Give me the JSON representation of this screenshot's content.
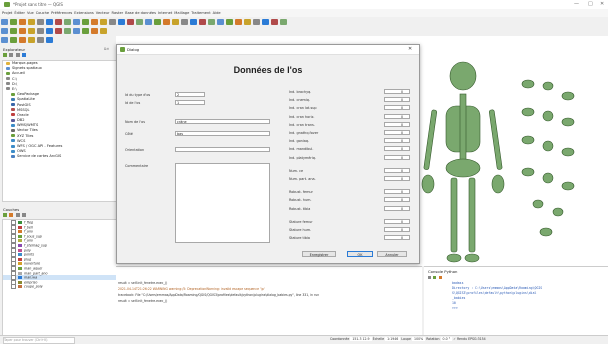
{
  "window": {
    "title": "*Projet sans titre — QGIS"
  },
  "menu": [
    "Projet",
    "Éditer",
    "Vue",
    "Couche",
    "Préférences",
    "Extensions",
    "Vecteur",
    "Raster",
    "Base de données",
    "Internet",
    "Maillage",
    "Traitement",
    "Aide"
  ],
  "explorer": {
    "title": "Explorateur",
    "items": [
      "Marque-pages",
      "Signets spatiaux",
      "Accueil",
      "C:\\",
      "D:\\",
      "E:\\",
      "GeoPackage",
      "SpatiaLite",
      "PostGIS",
      "MSSQL",
      "Oracle",
      "DB2",
      "WMS/WMTS",
      "Vector Tiles",
      "XYZ Tiles",
      "WCS",
      "WFS / OGC API - Features",
      "OWS",
      "Service de cartes ArcGIS"
    ]
  },
  "layers": {
    "title": "Couches",
    "items": [
      "f_fleg",
      "f_bell",
      "f_ano",
      "f_sous_sup",
      "f_ano",
      "f_sternag_sup",
      "poly",
      "points",
      "plug",
      "ouverture",
      "man_aquel",
      "man_part_ano",
      "man.wa",
      "empriso",
      "coupe_poly"
    ]
  },
  "dialog": {
    "window_title": "Dialog",
    "heading": "Données de l'os",
    "id_type_os_label": "Id du type d'os",
    "id_type_os_value": "2",
    "id_os_label": "Id de l'os",
    "id_os_value": "1",
    "nom_label": "Nom de l'os",
    "nom_value": "crâne",
    "cote_label": "Côté",
    "cote_value": "bas",
    "orientation_label": "Orientation",
    "commentaire_label": "Commentaire",
    "right_fields": [
      "Ind. brachyq.",
      "Ind. cnemiq.",
      "Ind. cran lat.sup",
      "Ind. cran horiz.",
      "Ind. cran trans.",
      "Ind. gnathq.fover",
      "Ind. goniaq.",
      "Ind. mandibul.",
      "Ind. platymériq.",
      "Num. ce",
      "Num. part. ana.",
      "Robust. femur",
      "Robust. hum.",
      "Robust. tibia",
      "Stature femur",
      "Stature hum.",
      "Stature tibia"
    ],
    "spin_value": "0",
    "btn_save": "Enregistrer",
    "btn_ok": "OK",
    "btn_cancel": "Annuler"
  },
  "log": {
    "lines": [
      "result = self.init_fenetre.exec_()",
      "2021-04-14T21:26:22    WARNING    warning:/5: DeprecationWarning: invalid escape sequence '\\p'",
      "traceback: File \"C:/Users/emmas/AppData/Roaming/QGIS/QGIS3\\profiles\\default/python/plugins\\dialog_babies.py\", line 331, in run",
      "result = self.init_fenetre.exec_()"
    ]
  },
  "console": {
    "title": "Console Python",
    "lines": [
      "badass",
      "Directory : C:\\Users\\emmas\\AppData\\Roaming\\QGIS",
      "S\\QGIS3\\profiles\\default\\python\\plugins\\dial",
      "_babies",
      "10",
      ">>>"
    ]
  },
  "status": {
    "coordinate_label": "Coordonnée",
    "coordinate": "151.3 12.9",
    "scale_label": "Échelle",
    "scale": "1:1946",
    "magnifier_label": "Loupe",
    "magnifier": "100%",
    "rotation_label": "Rotation",
    "rotation": "0.0 °",
    "render_label": "Rendu",
    "crs": "EPSG:3154"
  },
  "search_placeholder": "Taper pour trouver (Ctrl+K)",
  "colors": {
    "bone": "#7aa86e",
    "accent": "#2b7bd6"
  }
}
